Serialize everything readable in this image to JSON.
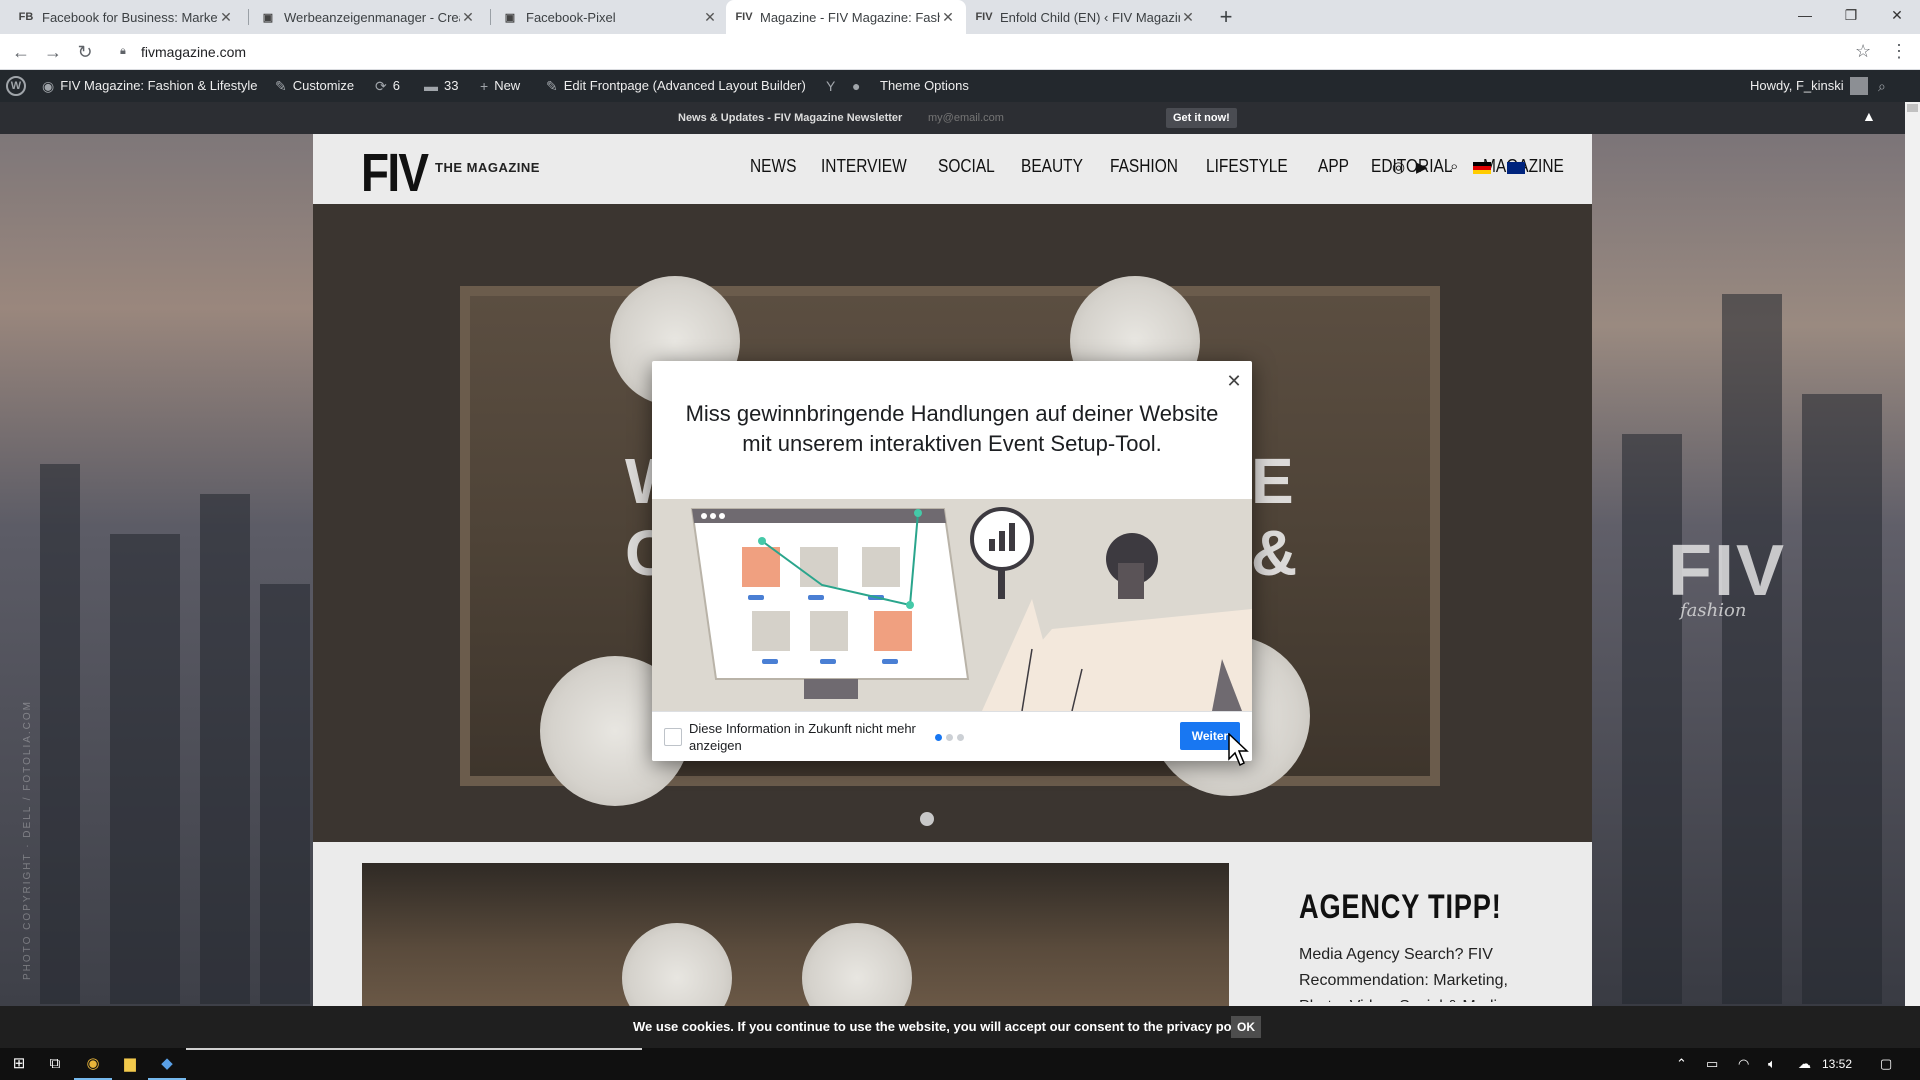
{
  "browser": {
    "tabs": [
      {
        "favicon": "FB",
        "label": "Facebook for Business: Marketing"
      },
      {
        "favicon": "▣",
        "label": "Werbeanzeigenmanager - Creatio"
      },
      {
        "favicon": "▣",
        "label": "Facebook-Pixel"
      },
      {
        "favicon": "FIV",
        "label": "Magazine - FIV Magazine: Fashio"
      },
      {
        "favicon": "FIV",
        "label": "Enfold Child (EN) ‹ FIV Magazine"
      }
    ],
    "active_tab": 3,
    "url": "fivmagazine.com"
  },
  "wp_admin_bar": {
    "site_name": "FIV Magazine: Fashion & Lifestyle",
    "customize": "Customize",
    "updates_count": "6",
    "comments_count": "33",
    "new": "New",
    "edit_frontpage": "Edit Frontpage (Advanced Layout Builder)",
    "theme_options": "Theme Options",
    "howdy": "Howdy, F_kinski"
  },
  "newsletter": {
    "label": "News & Updates - FIV Magazine Newsletter",
    "placeholder": "my@email.com",
    "button": "Get it now!"
  },
  "site_header": {
    "logo": "FIV",
    "logo_sub": "THE MAGAZINE",
    "nav": [
      "NEWS",
      "INTERVIEW",
      "SOCIAL",
      "BEAUTY",
      "FASHION",
      "LIFESTYLE",
      "APP",
      "EDITORIAL",
      "MAGAZINE"
    ]
  },
  "hero": {
    "letters": [
      "W",
      "C",
      "E",
      "&"
    ]
  },
  "background": {
    "logo": "FIV",
    "logo_sub": "fashion",
    "copyright": "PHOTO COPYRIGHT · DELL / FOTOLIA.COM"
  },
  "agency": {
    "title": "AGENCY TIPP!",
    "text": "Media Agency Search? FIV Recommendation: Marketing, Photo, Video, Social & Media"
  },
  "modal": {
    "title": "Miss gewinnbringende Handlungen auf deiner Website mit unserem interaktiven Event Setup-Tool.",
    "checkbox_label": "Diese Information in Zukunft nicht mehr anzeigen",
    "next_button": "Weiter",
    "page_count": 3,
    "current_page": 1
  },
  "cookie": {
    "text": "We use cookies. If you continue to use the website, you will accept our consent to the ",
    "link": "privacy policy",
    "after": ".",
    "ok": "OK"
  },
  "taskbar": {
    "time": "13:52"
  },
  "colors": {
    "wp_bar": "#23282d",
    "fb_blue": "#1877f2",
    "header_bg": "#ebebeb"
  }
}
